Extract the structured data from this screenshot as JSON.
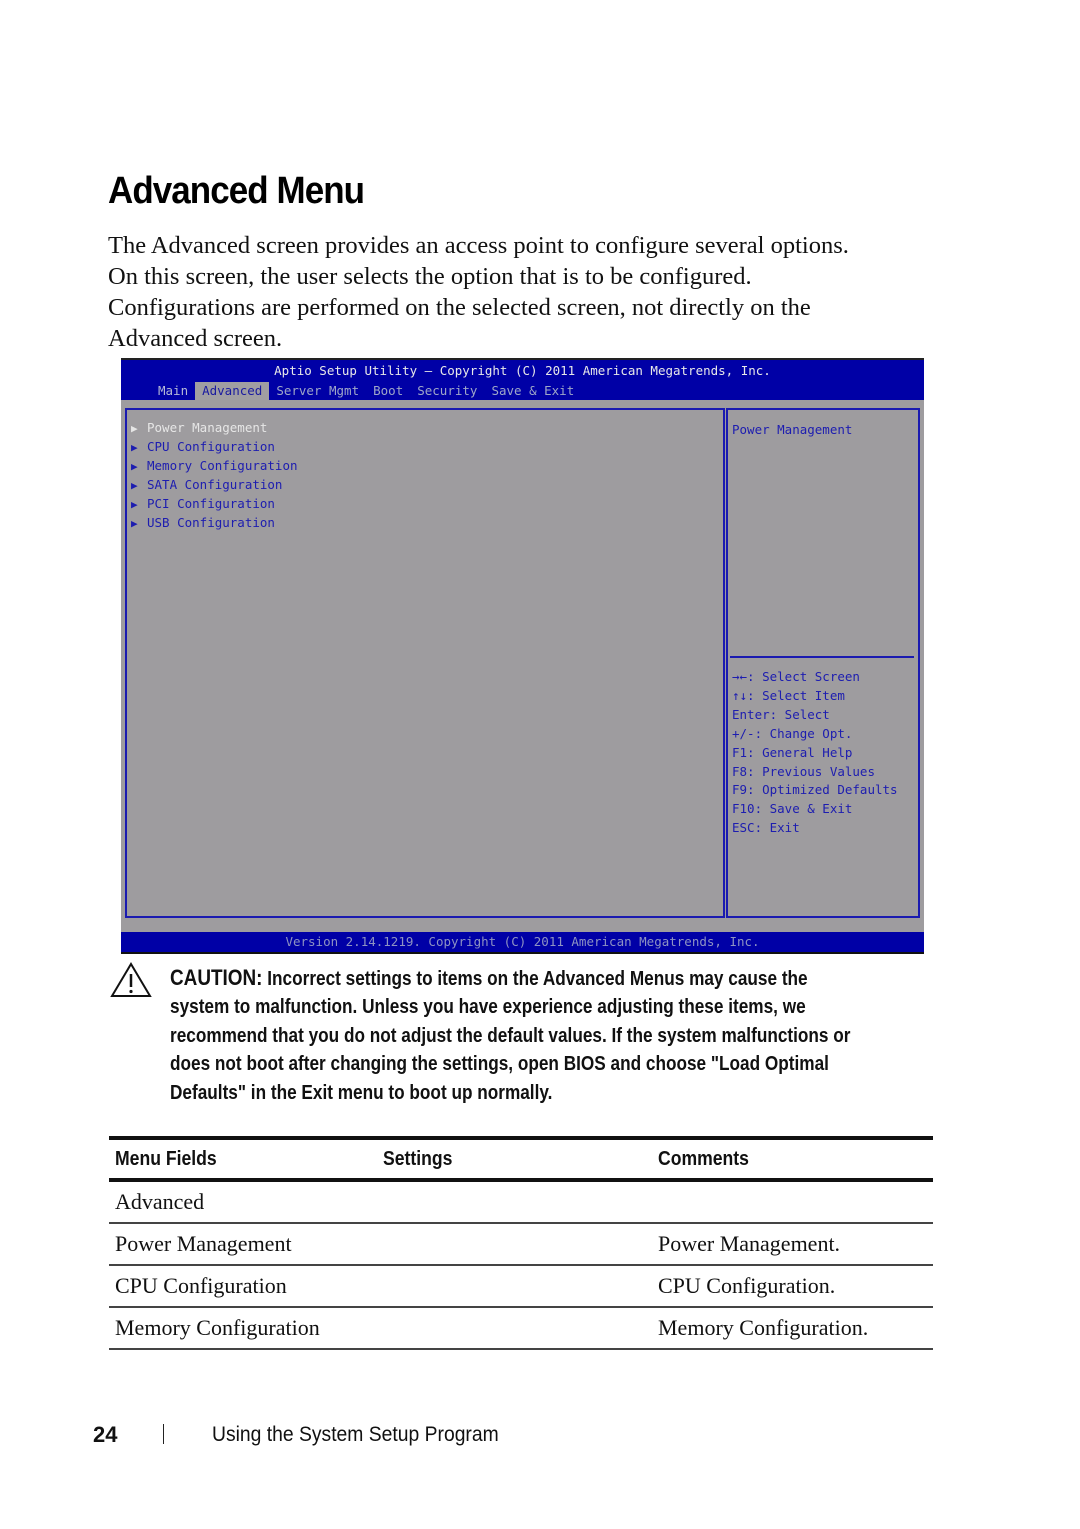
{
  "page": {
    "title": "Advanced Menu",
    "intro_lines": [
      "The Advanced screen provides an access point to configure several options.",
      "On this screen, the user selects the option that is to be configured.",
      "Configurations are performed on the selected screen, not directly on the",
      "Advanced screen."
    ]
  },
  "bios": {
    "title": "Aptio Setup Utility – Copyright (C) 2011 American Megatrends, Inc.",
    "tabs": [
      "Main",
      "Advanced",
      "Server Mgmt",
      "Boot",
      "Security",
      "Save & Exit"
    ],
    "active_tab": "Advanced",
    "items": [
      {
        "label": "Power Management",
        "selected": true
      },
      {
        "label": "CPU Configuration",
        "selected": false
      },
      {
        "label": "Memory Configuration",
        "selected": false
      },
      {
        "label": "SATA Configuration",
        "selected": false
      },
      {
        "label": "PCI Configuration",
        "selected": false
      },
      {
        "label": "USB Configuration",
        "selected": false
      }
    ],
    "item_arrow_icon": "triangle-right-icon",
    "help_text": "Power Management",
    "keys": [
      "→←: Select Screen",
      "↑↓: Select Item",
      "Enter: Select",
      "+/-: Change Opt.",
      "F1: General Help",
      "F8: Previous Values",
      "F9: Optimized Defaults",
      "F10: Save & Exit",
      "ESC: Exit"
    ],
    "footer": "Version 2.14.1219. Copyright (C) 2011 American Megatrends, Inc.",
    "colors": {
      "header_bg": "#0000a6",
      "body_bg": "#9e9c9f",
      "text_blue": "#1d1db0"
    }
  },
  "caution": {
    "icon": "warning-triangle-icon",
    "label": "CAUTION:",
    "lines": [
      "Incorrect settings to items on the Advanced Menus may cause the",
      "system to malfunction. Unless you have experience adjusting these items, we",
      "recommend that you do not adjust the default values. If the system malfunctions or",
      "does not boot after changing the settings, open BIOS and choose \"Load Optimal",
      "Defaults\" in the Exit menu to boot up normally."
    ]
  },
  "table": {
    "headers": [
      "Menu Fields",
      "Settings",
      "Comments"
    ],
    "section": "Advanced",
    "rows": [
      {
        "field": "Power Management",
        "settings": "",
        "comments": "Power Management."
      },
      {
        "field": "CPU Configuration",
        "settings": "",
        "comments": "CPU Configuration."
      },
      {
        "field": "Memory Configuration",
        "settings": "",
        "comments": "Memory Configuration."
      }
    ]
  },
  "footer": {
    "page_number": "24",
    "section_title": "Using the System Setup Program"
  }
}
